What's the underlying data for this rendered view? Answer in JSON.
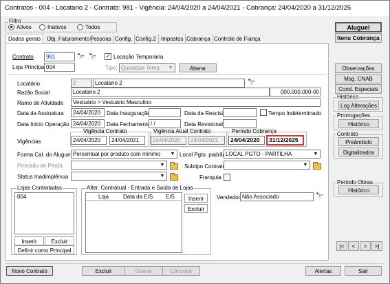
{
  "window": {
    "title": "Contratos - 004 - Locatario 2 - Contrato: 981 - Vigência: 24/04/2020 a 24/04/2021 - Cobrança: 24/04/2020 a 31/12/2025",
    "minimize": "—",
    "maximize": "☐",
    "close": "✕"
  },
  "filtro": {
    "label": "Filtro",
    "options": [
      "Ativos",
      "Inativos",
      "Todos"
    ],
    "selected": "Ativos"
  },
  "tabs": [
    "Dados gerais",
    "Obj. Faturamento",
    "Pessoas",
    "Config.",
    "Config.2",
    "Impostos",
    "Cobrança",
    "Controle de Fiança"
  ],
  "active_tab": "Dados gerais",
  "form": {
    "contrato_label": "Contrato",
    "contrato_value": "981",
    "locacao_temporaria_label": "Locação Temporária",
    "locacao_temporaria_checked": "✓",
    "loja_principal_label": "Loja Principal",
    "loja_principal_value": "004",
    "tipo_label": "Tipo:",
    "tipo_value": "Quiosque Temp",
    "alterar_label": "Alterar",
    "locatario_label": "Locatário",
    "locatario_code": "2",
    "locatario_name": "Locatario 2",
    "razao_social_label": "Razão Social",
    "razao_social_value": "Locatario 2",
    "cnpj_value": "000.000.000-00",
    "ramo_label": "Ramo de Atividade",
    "ramo_value": "Vestuário > Vestuário Masculino",
    "data_assinatura_label": "Data da Assinatura",
    "data_assinatura_value": "24/04/2020",
    "data_inauguracao_label": "Data Inauguração",
    "data_inauguracao_value": "",
    "data_rescisao_label": "Data da Rescisão",
    "data_rescisao_value": "",
    "tempo_indeterminado_label": "Tempo Indeterminado",
    "data_inicio_label": "Data Início Operação",
    "data_inicio_value": "24/04/2020",
    "data_fechamento_label": "Data Fechamento",
    "data_fechamento_value": " / /",
    "data_revisional_label": "Data Revisional",
    "data_revisional_value": "",
    "vigencias_label": "Vigências",
    "vigencia_contrato_label": "Vigência Contrato",
    "vigencia_contrato_start": "24/04/2020",
    "vigencia_contrato_end": "24/04/2021",
    "vigencia_atual_label": "Vigência Atual Contrato",
    "vigencia_atual_start": "24/04/2020",
    "vigencia_atual_end": "24/04/2021",
    "periodo_cobranca_label": "Período Cobrança",
    "periodo_cobranca_start": "24/04/2020",
    "periodo_cobranca_end": "31/12/2025",
    "forma_calculo_label": "Forma Cal. do Aluguel",
    "forma_calculo_value": "Percentual por produto com mínimo",
    "local_pgto_label": "Local Pgto. padrão",
    "local_pgto_value": "LOCAL PGTO - PARTILHA",
    "provisao_label": "Provisão de Perda",
    "provisao_value": "",
    "subtipo_label": "Subtipo Contrato",
    "subtipo_value": "",
    "status_label": "Status Inadimplência",
    "status_value": "",
    "franquia_label": "Franquia",
    "vendedor_label": "Vendedor",
    "vendedor_value": "Não Associado"
  },
  "lojas": {
    "title": "Lojas Contratadas",
    "items": [
      "004"
    ],
    "inserir": "Inserir",
    "excluir": "Excluir",
    "definir": "Definir como Principal"
  },
  "alter": {
    "title": "Alter. Contratual - Entrada e Saída de Lojas",
    "columns": [
      "Loja",
      "Data da E/S",
      "E/S"
    ],
    "inserir": "Inserir",
    "excluir": "Excluir"
  },
  "sidebar": {
    "aluguel": "Aluguel",
    "itens_cobranca": "Itens Cobrança",
    "observacoes": "Observações",
    "msg_cnab": "Msg. CNAB",
    "cond_especiais": "Cond. Especiais",
    "historico_group": "Histórico",
    "log_alteracoes": "Log Alterações",
    "prorrogacoes_group": "Prorrogações",
    "historico_btn": "Histórico",
    "contrato_group": "Contrato",
    "preambulo": "Preâmbulo",
    "digitalizados": "Digitalizados",
    "periodo_obras_group": "Período Obras",
    "historico_obras": "Histórico",
    "nav": [
      "|<",
      "<",
      ">",
      ">|"
    ]
  },
  "footer": {
    "novo_contrato": "Novo Contrato",
    "excluir": "Excluir",
    "gravar": "Gravar",
    "cancelar": "Cancelar",
    "alertas": "Alertas",
    "sair": "Sair"
  }
}
